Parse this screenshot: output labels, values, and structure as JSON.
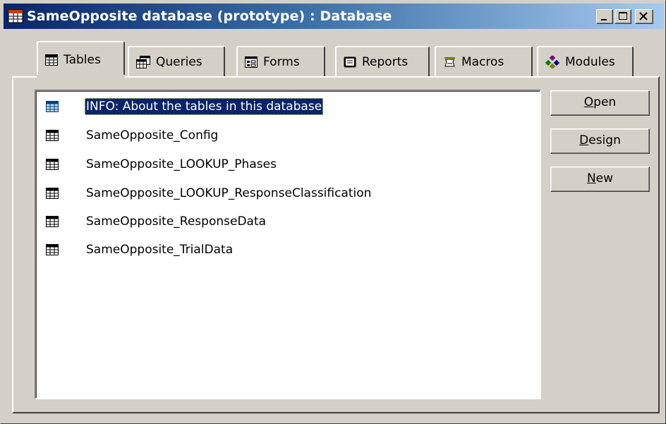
{
  "window": {
    "title": "SameOpposite database (prototype) : Database",
    "icon": "database-window-icon"
  },
  "caption_buttons": {
    "minimize": "minimize-icon",
    "maximize": "maximize-icon",
    "close": "close-icon"
  },
  "tabs": [
    {
      "label": "Tables",
      "icon": "table-icon",
      "active": true
    },
    {
      "label": "Queries",
      "icon": "query-icon",
      "active": false
    },
    {
      "label": "Forms",
      "icon": "form-icon",
      "active": false
    },
    {
      "label": "Reports",
      "icon": "report-icon",
      "active": false
    },
    {
      "label": "Macros",
      "icon": "macro-icon",
      "active": false
    },
    {
      "label": "Modules",
      "icon": "module-icon",
      "active": false
    }
  ],
  "objects": [
    {
      "name": "INFO: About the tables in this database",
      "selected": true
    },
    {
      "name": "SameOpposite_Config",
      "selected": false
    },
    {
      "name": "SameOpposite_LOOKUP_Phases",
      "selected": false
    },
    {
      "name": "SameOpposite_LOOKUP_ResponseClassification",
      "selected": false
    },
    {
      "name": "SameOpposite_ResponseData",
      "selected": false
    },
    {
      "name": "SameOpposite_TrialData",
      "selected": false
    }
  ],
  "commands": {
    "open": {
      "access_key": "O",
      "rest": "pen"
    },
    "design": {
      "access_key": "D",
      "rest": "esign"
    },
    "new": {
      "access_key": "N",
      "rest": "ew"
    }
  },
  "colors": {
    "face": "#d4d0c8",
    "title_start": "#0a246a",
    "title_end": "#a6caf0",
    "selection": "#0a246a"
  }
}
